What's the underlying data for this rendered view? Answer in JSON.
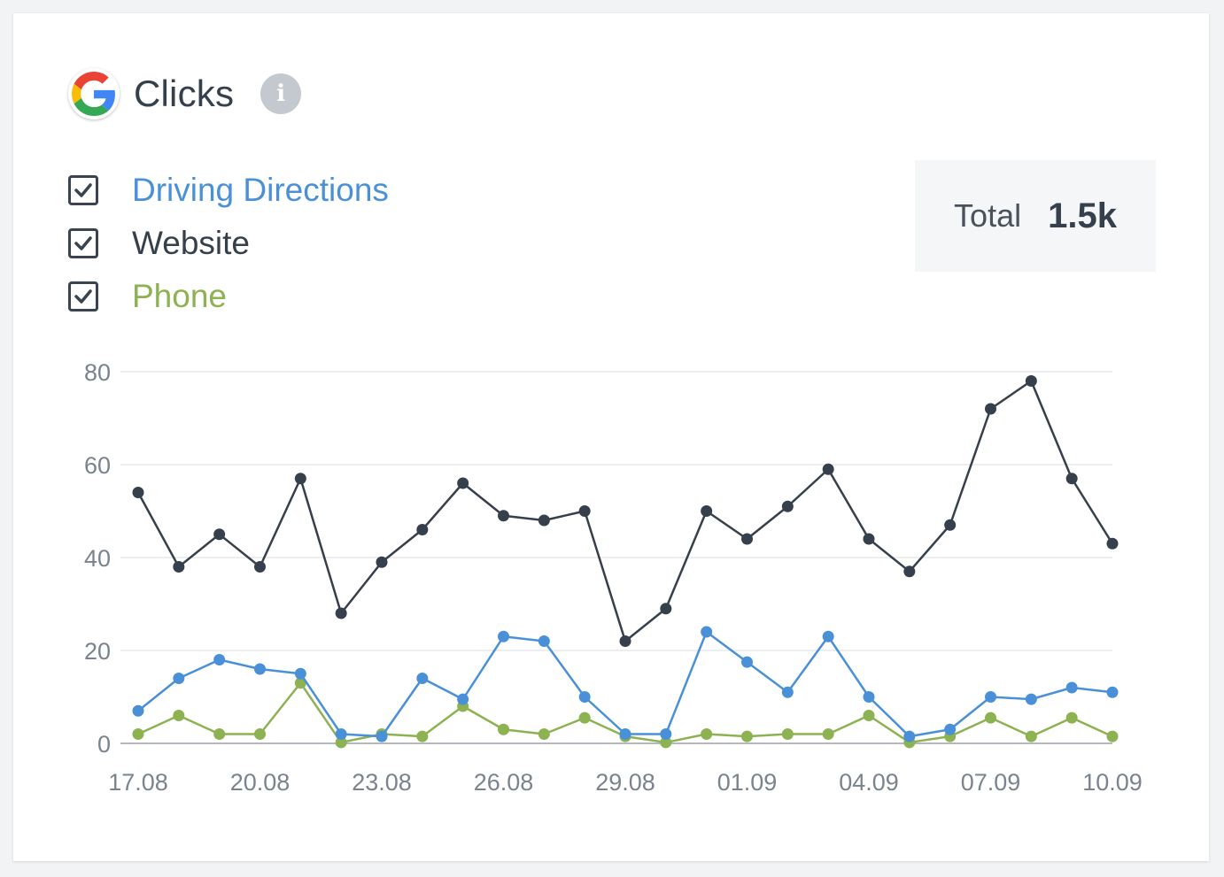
{
  "header": {
    "title": "Clicks",
    "logo_icon": "google-g-icon",
    "info_icon": "info-icon",
    "info_glyph": "i"
  },
  "legend": [
    {
      "label": "Driving Directions",
      "checked": true,
      "color": "#4a90d9"
    },
    {
      "label": "Website",
      "checked": true,
      "color": "#36404c"
    },
    {
      "label": "Phone",
      "checked": true,
      "color": "#8cb251"
    }
  ],
  "total": {
    "label": "Total",
    "value": "1.5k"
  },
  "chart_data": {
    "type": "line",
    "x": [
      "17.08",
      "18.08",
      "19.08",
      "20.08",
      "21.08",
      "22.08",
      "23.08",
      "24.08",
      "25.08",
      "26.08",
      "27.08",
      "28.08",
      "29.08",
      "30.08",
      "31.08",
      "01.09",
      "02.09",
      "03.09",
      "04.09",
      "05.09",
      "06.09",
      "07.09",
      "08.09",
      "09.09",
      "10.09"
    ],
    "x_tick_labels": [
      "17.08",
      "20.08",
      "23.08",
      "26.08",
      "29.08",
      "01.09",
      "04.09",
      "07.09",
      "10.09"
    ],
    "y_ticks": [
      0,
      20,
      40,
      60,
      80
    ],
    "ylim": [
      0,
      80
    ],
    "grid": true,
    "series": [
      {
        "name": "Website",
        "color": "#36404c",
        "values": [
          54,
          38,
          45,
          38,
          57,
          28,
          39,
          46,
          56,
          49,
          48,
          50,
          22,
          29,
          50,
          44,
          51,
          59,
          44,
          37,
          47,
          72,
          78,
          57,
          43
        ]
      },
      {
        "name": "Driving Directions",
        "color": "#4a90d9",
        "values": [
          7,
          14,
          18,
          16,
          15,
          2,
          1.5,
          14,
          9.5,
          23,
          22,
          10,
          2,
          2,
          24,
          17.5,
          11,
          23,
          10,
          1.5,
          3,
          10,
          9.5,
          12,
          11
        ]
      },
      {
        "name": "Phone",
        "color": "#8cb251",
        "values": [
          2,
          6,
          2,
          2,
          13,
          0.2,
          2,
          1.5,
          8,
          3,
          2,
          5.5,
          1.5,
          0.2,
          2,
          1.5,
          2,
          2,
          6,
          0.2,
          1.5,
          5.5,
          1.5,
          5.5,
          1.5
        ]
      }
    ]
  }
}
